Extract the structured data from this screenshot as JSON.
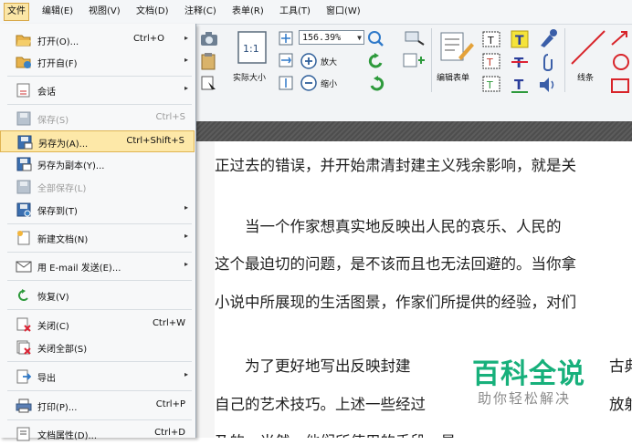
{
  "menubar": {
    "items": [
      "文件",
      "编辑(E)",
      "视图(V)",
      "文档(D)",
      "注释(C)",
      "表单(R)",
      "工具(T)",
      "窗口(W)"
    ]
  },
  "toolbar": {
    "zoom_value": "156.39%",
    "actual_size_label": "实际大小",
    "actual_size_glyph": "1:1",
    "zoom_in_label": "放大",
    "zoom_out_label": "缩小",
    "edit_form_label": "编辑表单",
    "line_label": "线条"
  },
  "file_menu": {
    "items": [
      {
        "label": "打开(O)...",
        "shortcut": "Ctrl+O",
        "arrow": "▸",
        "icon": "open-folder-icon"
      },
      {
        "label": "打开自(F)",
        "shortcut": "",
        "arrow": "▸",
        "icon": "open-from-icon"
      },
      {
        "label": "会话",
        "shortcut": "",
        "arrow": "▸",
        "icon": "session-icon"
      },
      {
        "label": "保存(S)",
        "shortcut": "Ctrl+S",
        "arrow": "",
        "icon": "save-icon"
      },
      {
        "label": "另存为(A)...",
        "shortcut": "Ctrl+Shift+S",
        "arrow": "",
        "icon": "save-as-icon"
      },
      {
        "label": "另存为副本(Y)...",
        "shortcut": "",
        "arrow": "",
        "icon": "save-copy-icon"
      },
      {
        "label": "全部保存(L)",
        "shortcut": "",
        "arrow": "",
        "icon": "save-all-icon"
      },
      {
        "label": "保存到(T)",
        "shortcut": "",
        "arrow": "▸",
        "icon": "save-to-icon"
      },
      {
        "label": "新建文档(N)",
        "shortcut": "",
        "arrow": "▸",
        "icon": "new-document-icon"
      },
      {
        "label": "用 E-mail 发送(E)...",
        "shortcut": "",
        "arrow": "▸",
        "icon": "email-icon"
      },
      {
        "label": "恢复(V)",
        "shortcut": "",
        "arrow": "",
        "icon": "revert-icon"
      },
      {
        "label": "关闭(C)",
        "shortcut": "Ctrl+W",
        "arrow": "",
        "icon": "close-document-icon"
      },
      {
        "label": "关闭全部(S)",
        "shortcut": "",
        "arrow": "",
        "icon": "close-all-icon"
      },
      {
        "label": "导出",
        "shortcut": "",
        "arrow": "▸",
        "icon": "export-icon"
      },
      {
        "label": "打印(P)...",
        "shortcut": "Ctrl+P",
        "arrow": "",
        "icon": "print-icon"
      },
      {
        "label": "文档属性(D)...",
        "shortcut": "Ctrl+D",
        "arrow": "",
        "icon": "properties-icon"
      }
    ]
  },
  "document": {
    "lines": [
      "正过去的错误，并开始肃清封建主义残余影响，就是关",
      "　　当一个作家想真实地反映出人民的哀乐、人民的",
      "这个最迫切的问题，是不该而且也无法回避的。当你拿",
      "小说中所展现的生活图景，作家们所提供的经验，对们",
      "　　为了更好地写出反映封建",
      "自己的艺术技巧。上述一些经过",
      "乃的，当然，他们所使用的手段，是是适合于他们所要"
    ],
    "line_tail_4": "古典",
    "line_tail_5": "放射"
  },
  "watermark": {
    "title": "百科全说",
    "subtitle": "助你轻松解决"
  },
  "colors": {
    "menu_highlight": "#fde8a8",
    "watermark_green": "#17b07b",
    "dark_strip": "#555555"
  }
}
